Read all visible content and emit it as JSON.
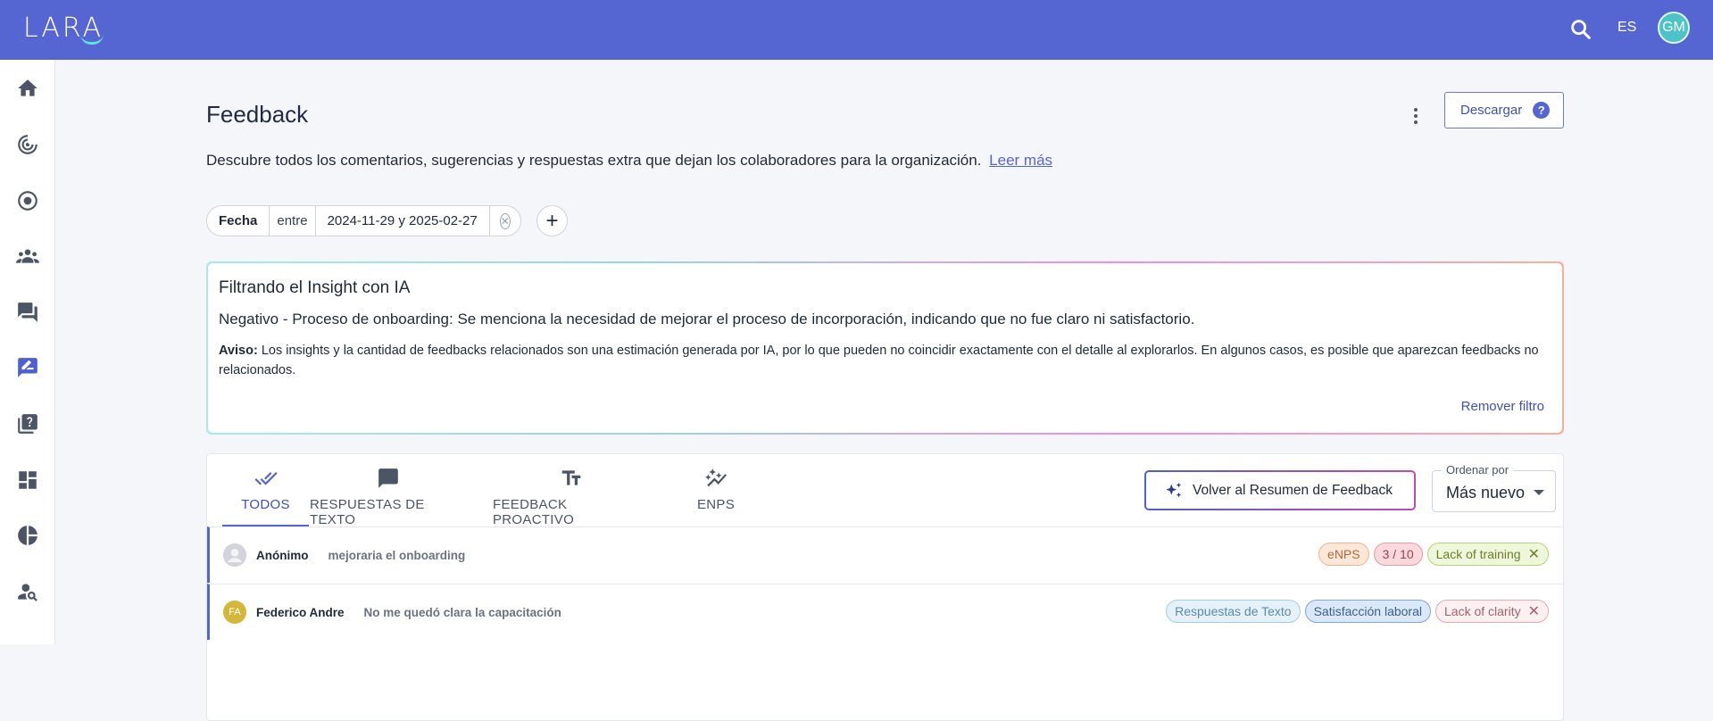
{
  "topbar": {
    "logo": "LARA",
    "language": "ES",
    "avatar_initials": "GM"
  },
  "sidebar": {
    "items": [
      {
        "name": "home-icon"
      },
      {
        "name": "radar-icon"
      },
      {
        "name": "target-icon"
      },
      {
        "name": "people-icon"
      },
      {
        "name": "chat-icon"
      },
      {
        "name": "feedback-icon",
        "active": true
      },
      {
        "name": "quiz-icon"
      },
      {
        "name": "dashboard-icon"
      },
      {
        "name": "pie-chart-icon"
      },
      {
        "name": "person-search-icon"
      }
    ]
  },
  "header": {
    "title": "Feedback",
    "download_label": "Descargar",
    "help_label": "?",
    "description": "Descubre todos los comentarios, sugerencias y respuestas extra que dejan los colaboradores para la organización.",
    "read_more": "Leer más"
  },
  "filter": {
    "field": "Fecha",
    "operator": "entre",
    "value": "2024-11-29 y 2025-02-27",
    "clear_icon": "✕",
    "add_label": "+"
  },
  "insight": {
    "title": "Filtrando el Insight con IA",
    "text": "Negativo - Proceso de onboarding: Se menciona la necesidad de mejorar el proceso de incorporación, indicando que no fue claro ni satisfactorio.",
    "note_label": "Aviso:",
    "note": "Los insights y la cantidad de feedbacks relacionados son una estimación generada por IA, por lo que pueden no coincidir exactamente con el detalle al explorarlos. En algunos casos, es posible que aparezcan feedbacks no relacionados.",
    "remove_label": "Remover filtro"
  },
  "tabs": [
    {
      "label": "TODOS",
      "icon": "double-check-icon",
      "active": true
    },
    {
      "label": "RESPUESTAS DE TEXTO",
      "icon": "comment-icon"
    },
    {
      "label": "FEEDBACK PROACTIVO",
      "icon": "text-fields-icon"
    },
    {
      "label": "ENPS",
      "icon": "auto-graph-icon"
    }
  ],
  "back_button": {
    "label": "Volver al Resumen de Feedback",
    "icon": "sparkles-icon"
  },
  "sort": {
    "label": "Ordenar por",
    "value": "Más nuevo"
  },
  "rows": [
    {
      "name": "Anónimo",
      "text": "mejoraria el onboarding",
      "avatar": "",
      "tags": [
        {
          "label": "eNPS",
          "bg": "#fde8d8",
          "border": "#f2b48e",
          "color": "#b5683a"
        },
        {
          "label": "3 / 10",
          "bg": "#fbd9dc",
          "border": "#e89aa2",
          "color": "#a0414b"
        },
        {
          "label": "Lack of training",
          "bg": "#eef7d9",
          "border": "#b8d47a",
          "color": "#6b7f2e",
          "removable": true,
          "x": "✕"
        }
      ]
    },
    {
      "name": "Federico Andre",
      "text": "No me quedó clara la capacitación",
      "avatar": "FA",
      "tags": [
        {
          "label": "Respuestas de Texto",
          "bg": "#e4f1f8",
          "border": "#a7cde3",
          "color": "#5d8aa6"
        },
        {
          "label": "Satisfacción laboral",
          "bg": "#dbe8f7",
          "border": "#7fa6d4",
          "color": "#3d5f8c"
        },
        {
          "label": "Lack of clarity",
          "bg": "#fdf0f1",
          "border": "#e5aab2",
          "color": "#a3626c",
          "removable": true,
          "x": "✕"
        }
      ]
    }
  ]
}
